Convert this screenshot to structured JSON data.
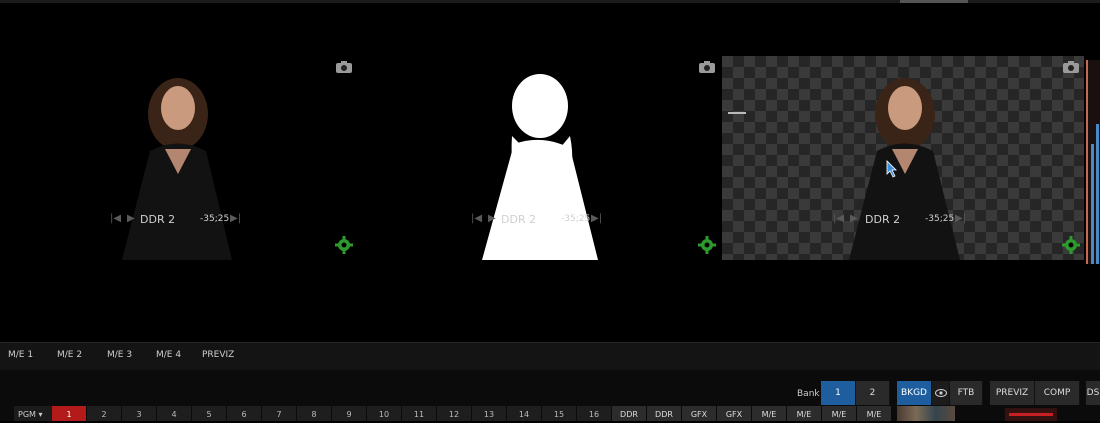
{
  "monitors": [
    {
      "source": "DDR 2",
      "timecode": "-35;25"
    },
    {
      "source": "DDR 2",
      "timecode": "-35;25"
    },
    {
      "source": "DDR 2",
      "timecode": "-35;25"
    }
  ],
  "tabs": [
    "M/E 1",
    "M/E 2",
    "M/E 3",
    "M/E 4",
    "PREVIZ"
  ],
  "switcher": {
    "bank_label": "Bank",
    "bank_buttons": [
      "1",
      "2"
    ],
    "bkgd_label": "BKGD",
    "ftb_label": "FTB",
    "previz_label": "PREVIZ",
    "comp_label": "COMP",
    "ds_label": "DS",
    "pgm_label": "PGM",
    "row_numbers": [
      "1",
      "2",
      "3",
      "4",
      "5",
      "6",
      "7",
      "8",
      "9",
      "10",
      "11",
      "12",
      "13",
      "14",
      "15",
      "16"
    ],
    "row_sources": [
      "DDR",
      "DDR",
      "GFX",
      "GFX",
      "M/E",
      "M/E",
      "M/E",
      "M/E"
    ]
  },
  "colors": {
    "accent_blue": "#1f5e9e",
    "program_red": "#b31b1b",
    "gear_green": "#2e9a2e"
  },
  "icons": [
    "camera-icon",
    "gear-icon",
    "eye-icon",
    "cursor-icon"
  ]
}
